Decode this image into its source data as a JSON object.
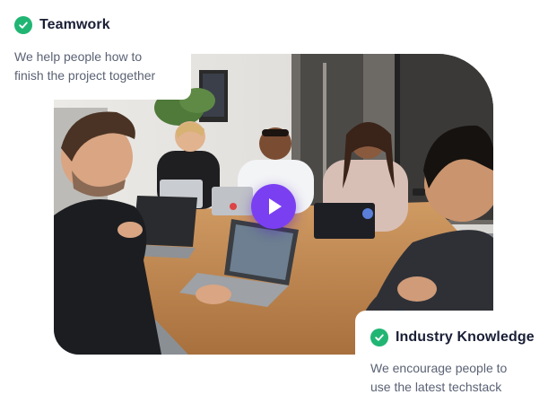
{
  "video": {
    "play_icon": "play-icon",
    "accent": "#7b3ff2"
  },
  "cards": [
    {
      "icon": "check-circle-icon",
      "icon_color": "#21b573",
      "title": "Teamwork",
      "description_line1": "We help people how to",
      "description_line2": "finish the project together"
    },
    {
      "icon": "check-circle-icon",
      "icon_color": "#21b573",
      "title": "Industry Knowledge",
      "description_line1": "We encourage people to",
      "description_line2": "use the latest techstack"
    }
  ]
}
